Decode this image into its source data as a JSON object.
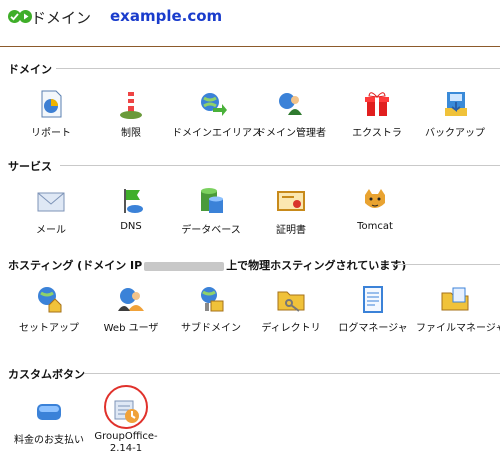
{
  "header": {
    "title": "ドメイン",
    "domain": "example.com",
    "status_colors": [
      "#3fae29",
      "#3fae29"
    ]
  },
  "sections": {
    "domain": {
      "title": "ドメイン",
      "items": [
        {
          "label": "リポート",
          "icon": "report-icon"
        },
        {
          "label": "制限",
          "icon": "limits-icon"
        },
        {
          "label": "ドメインエイリアス",
          "icon": "domain-alias-icon"
        },
        {
          "label": "ドメイン管理者",
          "icon": "domain-admin-icon"
        },
        {
          "label": "エクストラ",
          "icon": "extras-icon"
        },
        {
          "label": "バックアップ",
          "icon": "backup-icon"
        }
      ]
    },
    "services": {
      "title": "サービス",
      "items": [
        {
          "label": "メール",
          "icon": "mail-icon"
        },
        {
          "label": "DNS",
          "icon": "dns-icon"
        },
        {
          "label": "データベース",
          "icon": "database-icon"
        },
        {
          "label": "証明書",
          "icon": "certificate-icon"
        },
        {
          "label": "Tomcat",
          "icon": "tomcat-icon"
        }
      ]
    },
    "hosting": {
      "title_prefix": "ホスティング (ドメイン IP",
      "title_suffix": "上で物理ホスティングされています)",
      "items": [
        {
          "label": "セットアップ",
          "icon": "setup-icon"
        },
        {
          "label": "Web ユーザ",
          "icon": "web-users-icon"
        },
        {
          "label": "サブドメイン",
          "icon": "subdomain-icon"
        },
        {
          "label": "ディレクトリ",
          "icon": "directories-icon"
        },
        {
          "label": "ログマネージャ",
          "icon": "log-manager-icon"
        },
        {
          "label": "ファイルマネージャ",
          "icon": "file-manager-icon"
        }
      ]
    },
    "custom": {
      "title": "カスタムボタン",
      "items": [
        {
          "label": "料金のお支払い",
          "icon": "payment-icon"
        },
        {
          "label": "GroupOffice-2.14-1",
          "icon": "groupoffice-icon"
        }
      ]
    }
  }
}
